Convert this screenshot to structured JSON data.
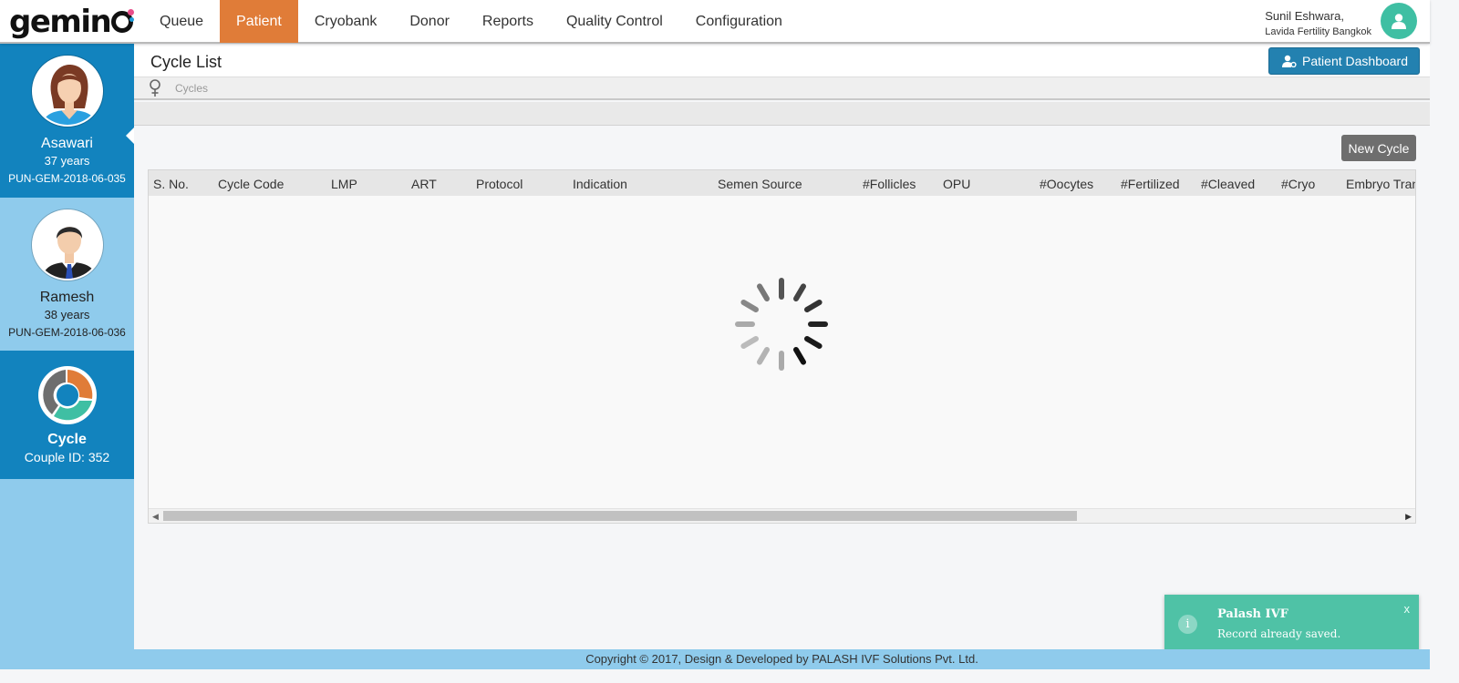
{
  "app": {
    "logo_text": "gemin"
  },
  "nav": {
    "items": [
      {
        "label": "Queue"
      },
      {
        "label": "Patient"
      },
      {
        "label": "Cryobank"
      },
      {
        "label": "Donor"
      },
      {
        "label": "Reports"
      },
      {
        "label": "Quality Control"
      },
      {
        "label": "Configuration"
      }
    ],
    "active": "Patient"
  },
  "user": {
    "name": "Sunil Eshwara,",
    "org": "Lavida Fertility Bangkok"
  },
  "sidebar": {
    "female": {
      "name": "Asawari",
      "age": "37 years",
      "id": "PUN-GEM-2018-06-035"
    },
    "male": {
      "name": "Ramesh",
      "age": "38 years",
      "id": "PUN-GEM-2018-06-036"
    },
    "cycle": {
      "title": "Cycle",
      "couple_id": "Couple ID: 352"
    }
  },
  "page": {
    "title": "Cycle List",
    "dashboard_button": "Patient Dashboard",
    "breadcrumb": "Cycles",
    "new_cycle_button": "New Cycle"
  },
  "grid": {
    "columns": [
      "S. No.",
      "Cycle Code",
      "LMP",
      "ART",
      "Protocol",
      "Indication",
      "Semen Source",
      "#Follicles",
      "OPU",
      "#Oocytes",
      "#Fertilized",
      "#Cleaved",
      "#Cryo",
      "Embryo Tran"
    ],
    "rows": [],
    "loading": true
  },
  "toast": {
    "title": "Palash IVF",
    "message": "Record already saved.",
    "close": "x",
    "icon": "i"
  },
  "footer": {
    "text": "Copyright © 2017, Design & Developed by PALASH IVF Solutions Pvt. Ltd."
  },
  "colors": {
    "nav_active": "#e07c38",
    "sidebar_dark": "#1283be",
    "sidebar_light": "#8fcbec",
    "button_primary": "#2381b0",
    "toast": "#4fc2a6",
    "user_avatar": "#3fbfa3"
  }
}
